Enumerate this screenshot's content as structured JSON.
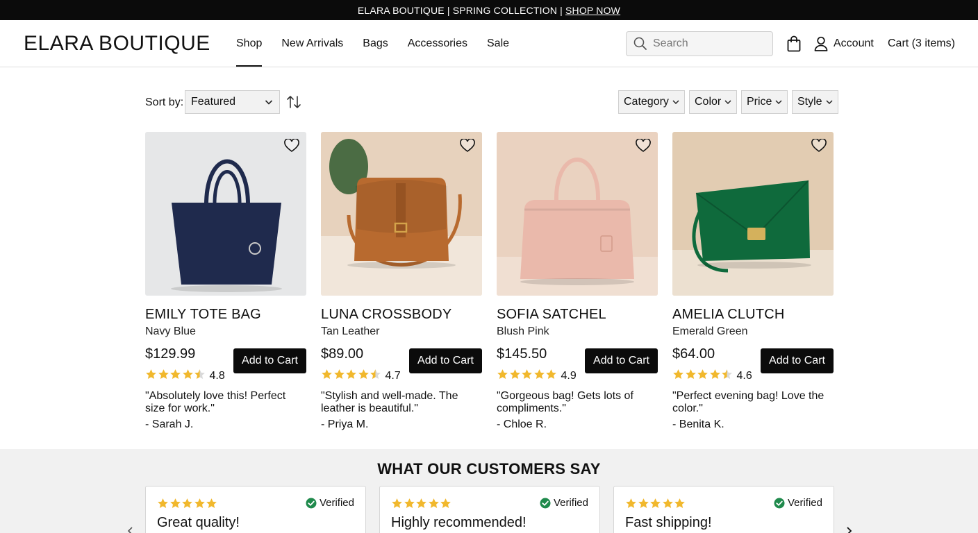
{
  "promo": {
    "brand": "ELARA BOUTIQUE",
    "separator": "|",
    "collection": "SPRING COLLECTION",
    "cta": "SHOP NOW"
  },
  "header": {
    "logo": "ELARA BOUTIQUE",
    "nav": [
      {
        "label": "Shop",
        "active": true
      },
      {
        "label": "New Arrivals",
        "active": false
      },
      {
        "label": "Bags",
        "active": false
      },
      {
        "label": "Accessories",
        "active": false
      },
      {
        "label": "Sale",
        "active": false
      }
    ],
    "search_placeholder": "Search",
    "account_label": "Account",
    "cart_label": "Cart (3 items)"
  },
  "toolbar": {
    "sort_label": "Sort by:",
    "sort_value": "Featured",
    "filters": [
      "Category",
      "Color",
      "Price",
      "Style"
    ]
  },
  "products": [
    {
      "name": "EMILY TOTE BAG",
      "variant": "Navy Blue",
      "price": "$129.99",
      "rating": 4.8,
      "rating_text": "4.8",
      "quote": "\"Absolutely love this! Perfect size for work.\"",
      "author": "- Sarah J.",
      "button": "Add to Cart",
      "bag_color": "#1f2a4d",
      "bg_color": "#e6e7e8"
    },
    {
      "name": "LUNA CROSSBODY",
      "variant": "Tan Leather",
      "price": "$89.00",
      "rating": 4.7,
      "rating_text": "4.7",
      "quote": "\"Stylish and well-made. The leather is beautiful.\"",
      "author": "- Priya M.",
      "button": "Add to Cart",
      "bag_color": "#b86a2f",
      "bg_color": "#e7d2bd"
    },
    {
      "name": "SOFIA SATCHEL",
      "variant": "Blush Pink",
      "price": "$145.50",
      "rating": 4.9,
      "rating_text": "4.9",
      "quote": "\"Gorgeous bag! Gets lots of compliments.\"",
      "author": "- Chloe R.",
      "button": "Add to Cart",
      "bag_color": "#eab9ab",
      "bg_color": "#ead2c0"
    },
    {
      "name": "AMELIA CLUTCH",
      "variant": "Emerald Green",
      "price": "$64.00",
      "rating": 4.6,
      "rating_text": "4.6",
      "quote": "\"Perfect evening bag! Love the color.\"",
      "author": "- Benita K.",
      "button": "Add to Cart",
      "bag_color": "#0f6a3c",
      "bg_color": "#e2ccb2"
    }
  ],
  "testimonials": {
    "heading": "WHAT OUR CUSTOMERS SAY",
    "items": [
      {
        "title": "Great quality!",
        "verified": "Verified",
        "stars": 5
      },
      {
        "title": "Highly recommended!",
        "verified": "Verified",
        "stars": 5
      },
      {
        "title": "Fast shipping!",
        "verified": "Verified",
        "stars": 5
      }
    ]
  },
  "colors": {
    "star": "#f1b82d",
    "verified": "#1f8a4c",
    "button": "#0b0b0b"
  }
}
